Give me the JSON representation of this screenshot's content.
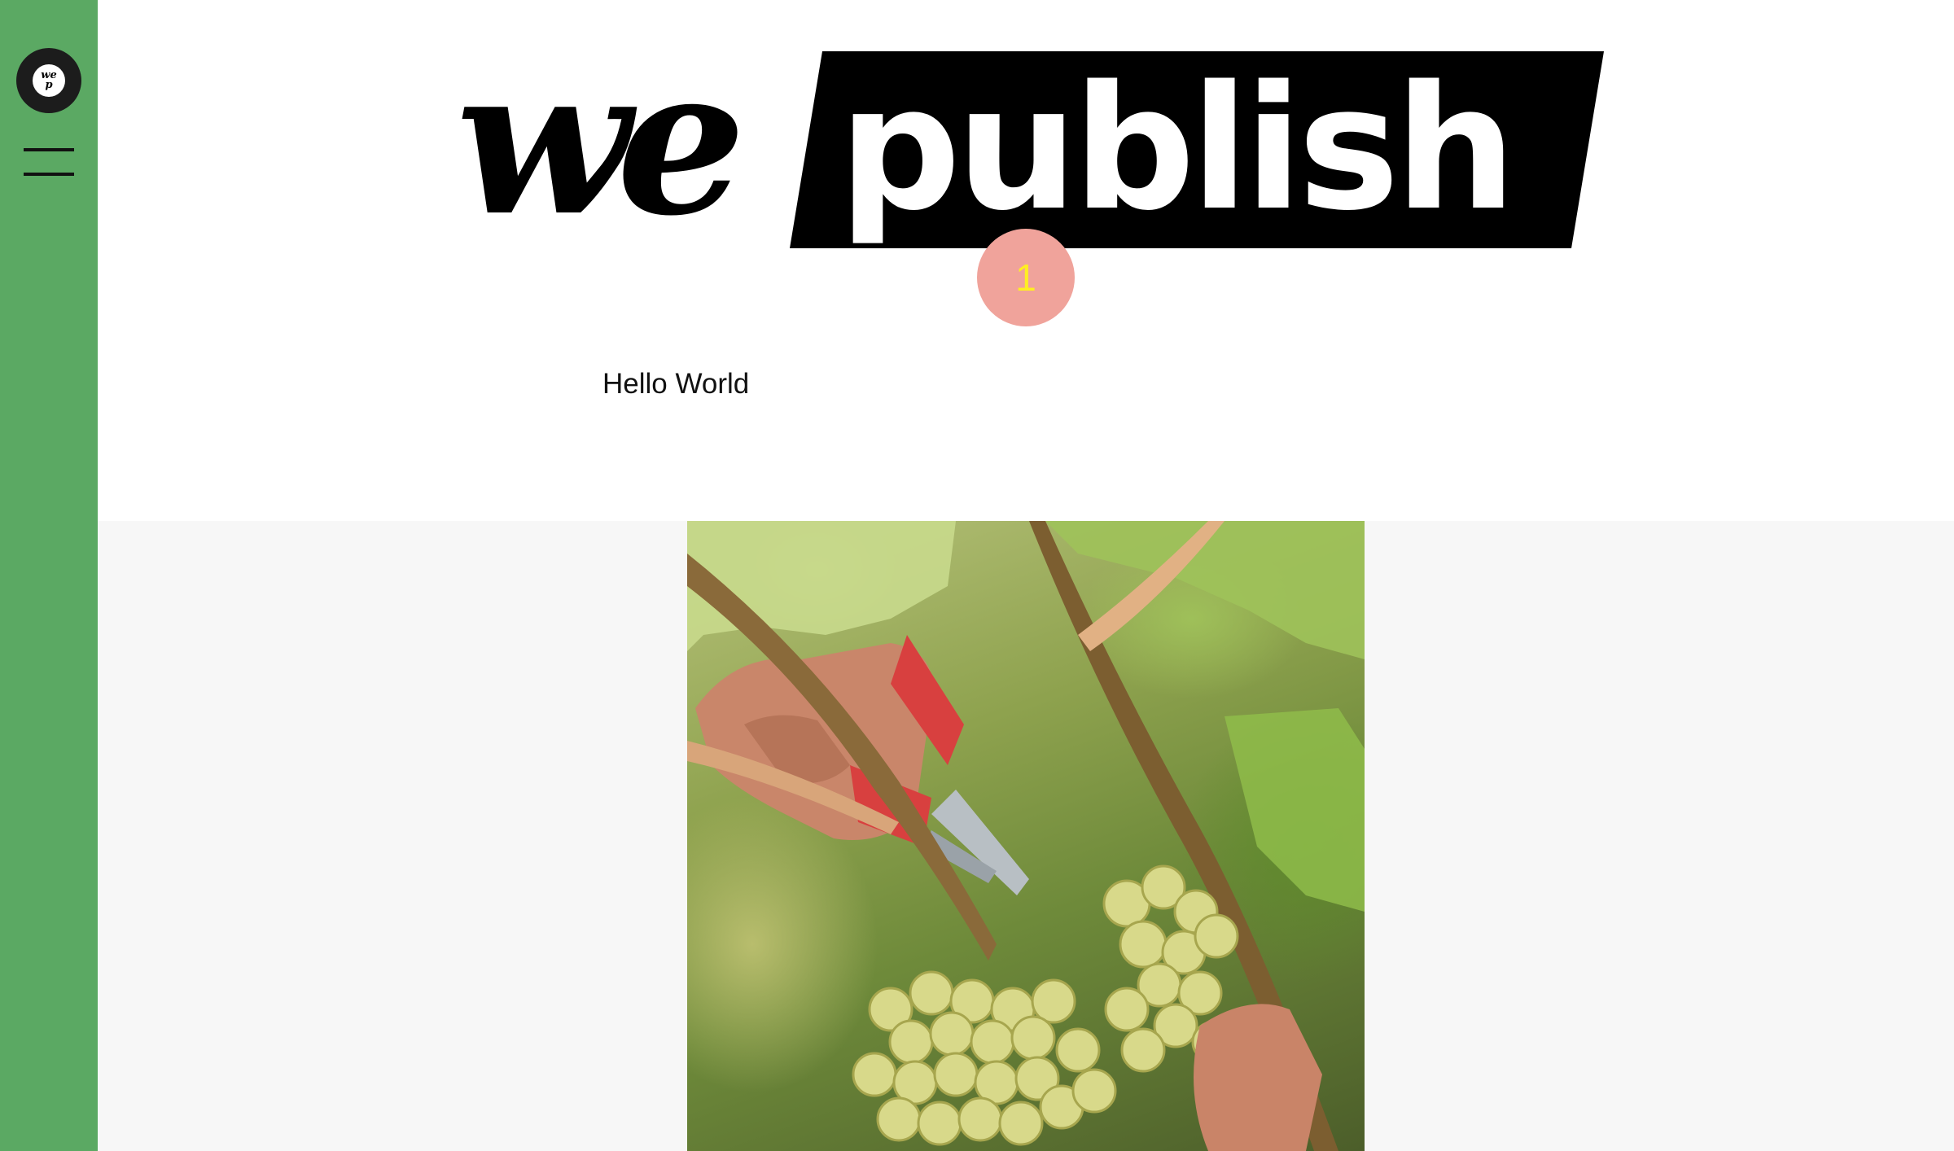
{
  "sidebar": {
    "logo_line1": "we",
    "logo_line2": "p"
  },
  "header": {
    "brand_left": "we",
    "brand_right": "publish",
    "badge_count": "1",
    "headline": "Hello World"
  },
  "colors": {
    "sidebar": "#5ba963",
    "badge": "#f0a39b",
    "badge_text": "#ffee22",
    "content_bg": "#f7f7f7"
  },
  "icons": {
    "menu": "hamburger-icon",
    "logo": "wepublish-logo"
  }
}
